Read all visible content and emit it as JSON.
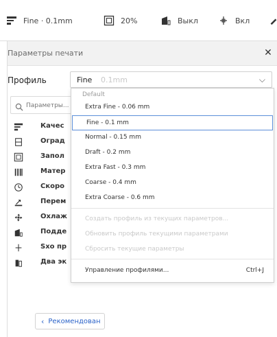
{
  "toolbar": {
    "profile_label": "Fine · 0.1mm",
    "infill_label": "20%",
    "support_label": "Выкл",
    "adhesion_label": "Вкл"
  },
  "panel": {
    "title": "Параметры печати",
    "profile_label": "Профиль",
    "profile_value": "Fine",
    "profile_value_sub": "0.1mm",
    "search_placeholder": "Параметры..."
  },
  "categories": [
    {
      "label": "Качес",
      "icon": "quality-icon"
    },
    {
      "label": "Оград",
      "icon": "walls-icon"
    },
    {
      "label": "Запол",
      "icon": "infill-icon"
    },
    {
      "label": "Матер",
      "icon": "material-icon"
    },
    {
      "label": "Скоро",
      "icon": "speed-icon"
    },
    {
      "label": "Перем",
      "icon": "travel-icon"
    },
    {
      "label": "Охлаж",
      "icon": "cooling-icon"
    },
    {
      "label": "Подде",
      "icon": "support-icon"
    },
    {
      "label": "Sxo пр",
      "icon": "adhesion-icon"
    },
    {
      "label": "Два эк",
      "icon": "dual-extrusion-icon"
    }
  ],
  "dropdown": {
    "section_label": "Default",
    "profiles": [
      "Extra Fine - 0.06 mm",
      "Fine - 0.1 mm",
      "Normal - 0.15 mm",
      "Draft - 0.2 mm",
      "Extra Fast - 0.3 mm",
      "Coarse - 0.4 mm",
      "Extra Coarse - 0.6 mm"
    ],
    "selected_index": 1,
    "actions": [
      "Создать профиль из текущих параметров...",
      "Обновить профиль текущими параметрами",
      "Сбросить текущие параметры"
    ],
    "manage_label": "Управление профилями...",
    "manage_shortcut": "Ctrl+J"
  },
  "footer": {
    "recommended_label": "Рекомендован"
  },
  "colors": {
    "accent": "#2a62c8",
    "selected_border": "#5b8ed8",
    "header_bg": "#f2f2f2"
  }
}
